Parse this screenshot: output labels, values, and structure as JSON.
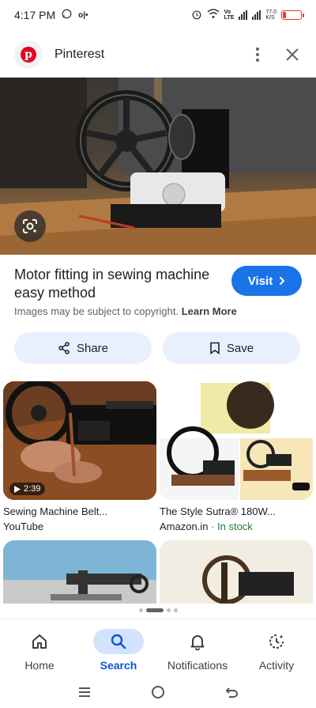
{
  "status_bar": {
    "time": "4:17 PM",
    "speed": "77.0\nK/S",
    "network_label": "Vo\nLTE"
  },
  "header": {
    "source_name": "Pinterest"
  },
  "result": {
    "title": "Motor fitting in sewing machine easy method",
    "visit_label": "Visit",
    "copyright_text": "Images may be subject to copyright.",
    "learn_more_label": "Learn More",
    "share_label": "Share",
    "save_label": "Save"
  },
  "related": [
    {
      "title": "Sewing Machine Belt...",
      "source": "YouTube",
      "duration": "2:39"
    },
    {
      "title": "The Style Sutra® 180W...",
      "source": "Amazon.in",
      "stock": "In stock"
    },
    {
      "title": "",
      "source": ""
    },
    {
      "title": "",
      "source": ""
    }
  ],
  "bottom_nav": [
    {
      "label": "Home",
      "icon": "home-icon",
      "active": false
    },
    {
      "label": "Search",
      "icon": "search-icon",
      "active": true
    },
    {
      "label": "Notifications",
      "icon": "bell-icon",
      "active": false
    },
    {
      "label": "Activity",
      "icon": "activity-icon",
      "active": false
    }
  ],
  "colors": {
    "accent": "#1a73e8",
    "pinterest": "#e60023",
    "in_stock": "#188038",
    "pill_bg": "#e8f0fe"
  }
}
